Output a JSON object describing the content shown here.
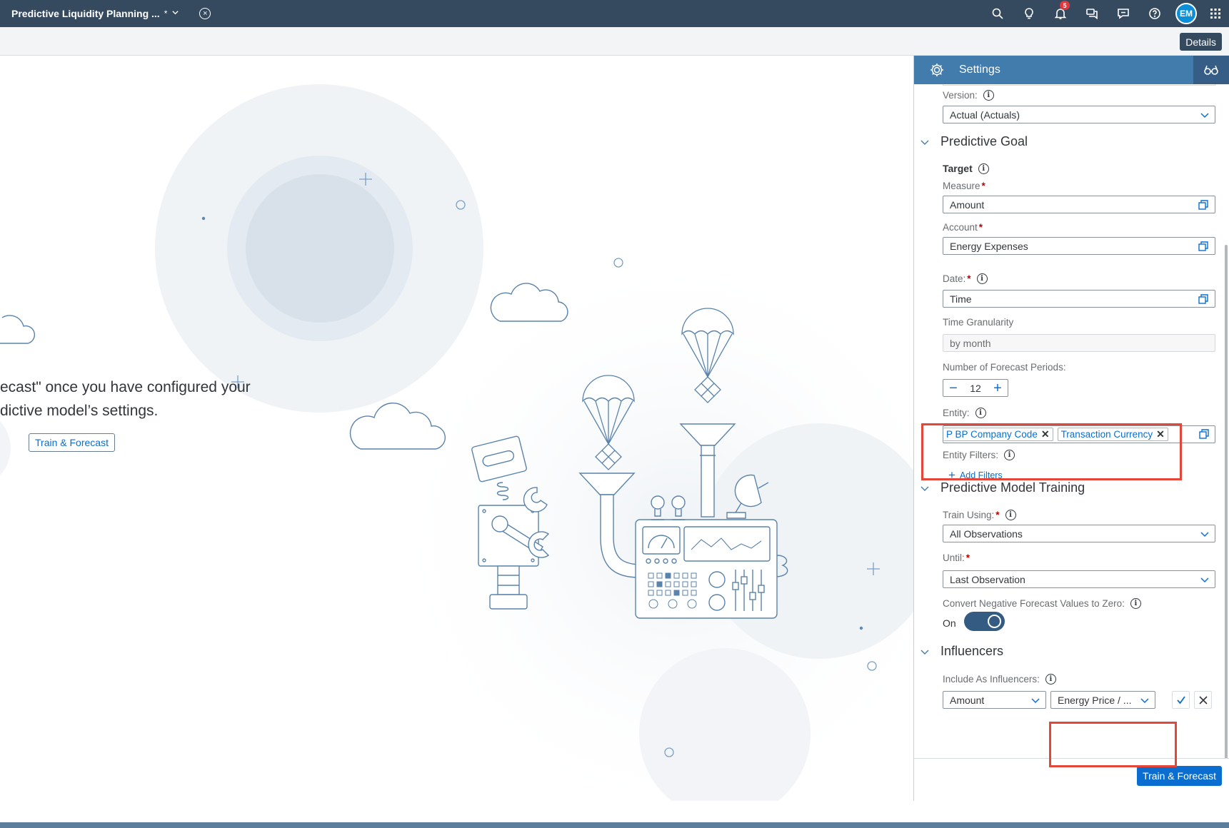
{
  "shell": {
    "title": "Predictive Liquidity Planning ...",
    "dirty_marker": "*",
    "notification_count": "5",
    "user_initials": "EM"
  },
  "toolbar": {
    "details_label": "Details"
  },
  "main": {
    "message_line1": "ecast\" once you have configured your",
    "message_line2": "dictive model’s settings.",
    "train_button": "Train & Forecast"
  },
  "panel": {
    "title": "Settings",
    "version_label": "Version:",
    "version_value": "Actual (Actuals)",
    "goal_section": "Predictive Goal",
    "target_label": "Target",
    "measure_label": "Measure",
    "measure_value": "Amount",
    "account_label": "Account",
    "account_value": "Energy Expenses",
    "date_label": "Date:",
    "date_value": "Time",
    "granularity_label": "Time Granularity",
    "granularity_value": "by month",
    "periods_label": "Number of Forecast Periods:",
    "periods_value": "12",
    "entity_label": "Entity:",
    "entity_tokens": [
      "P BP Company Code",
      "Transaction Currency"
    ],
    "entity_filters_label": "Entity Filters:",
    "add_filters": "Add Filters",
    "training_section": "Predictive Model Training",
    "train_using_label": "Train Using:",
    "train_using_value": "All Observations",
    "until_label": "Until:",
    "until_value": "Last Observation",
    "convert_label": "Convert Negative Forecast Values to Zero:",
    "toggle_state": "On",
    "influencers_section": "Influencers",
    "include_label": "Include As Influencers:",
    "influencer_measure": "Amount",
    "influencer_value": "Energy Price / ...",
    "footer_button": "Train & Forecast"
  },
  "colors": {
    "shell": "#354a5f",
    "panel_header": "#427cac",
    "accent": "#0a6ed1",
    "highlight": "#e2473a"
  }
}
